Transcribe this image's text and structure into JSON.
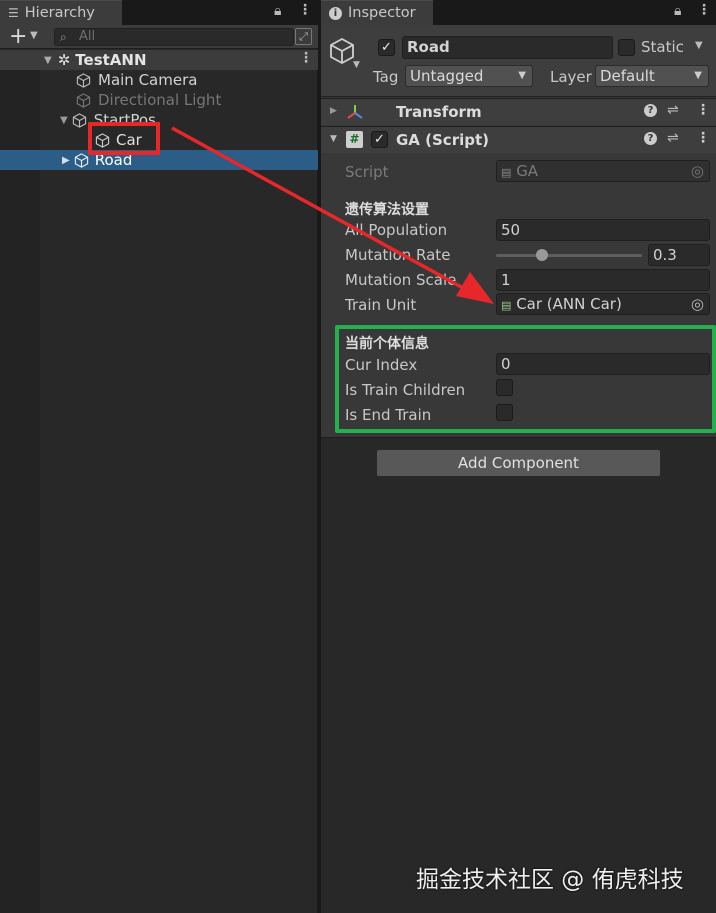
{
  "hierarchy": {
    "tab_title": "Hierarchy",
    "add_label": "+",
    "search_placeholder": "All",
    "scene_name": "TestANN",
    "items": {
      "main_camera": "Main Camera",
      "directional_light": "Directional Light",
      "start_pos": "StartPos",
      "car": "Car",
      "road": "Road"
    }
  },
  "inspector": {
    "tab_title": "Inspector",
    "object_name": "Road",
    "static_label": "Static",
    "tag_label": "Tag",
    "tag_value": "Untagged",
    "layer_label": "Layer",
    "layer_value": "Default",
    "transform": {
      "title": "Transform"
    },
    "script_component": {
      "title": "GA (Script)",
      "script_label": "Script",
      "script_value": "GA",
      "section1_title": "遗传算法设置",
      "all_population_label": "All Population",
      "all_population_value": "50",
      "mutation_rate_label": "Mutation Rate",
      "mutation_rate_value": "0.3",
      "mutation_scale_label": "Mutation Scale",
      "mutation_scale_value": "1",
      "train_unit_label": "Train Unit",
      "train_unit_value": "Car (ANN Car)",
      "section2_title": "当前个体信息",
      "cur_index_label": "Cur Index",
      "cur_index_value": "0",
      "is_train_children_label": "Is Train Children",
      "is_end_train_label": "Is End Train"
    },
    "add_component_label": "Add Component"
  },
  "watermark": "掘金技术社区 @ 侑虎科技",
  "colors": {
    "annotation_red": "#e8272a",
    "annotation_green": "#22b14c",
    "selection_blue": "#2c5d87"
  }
}
